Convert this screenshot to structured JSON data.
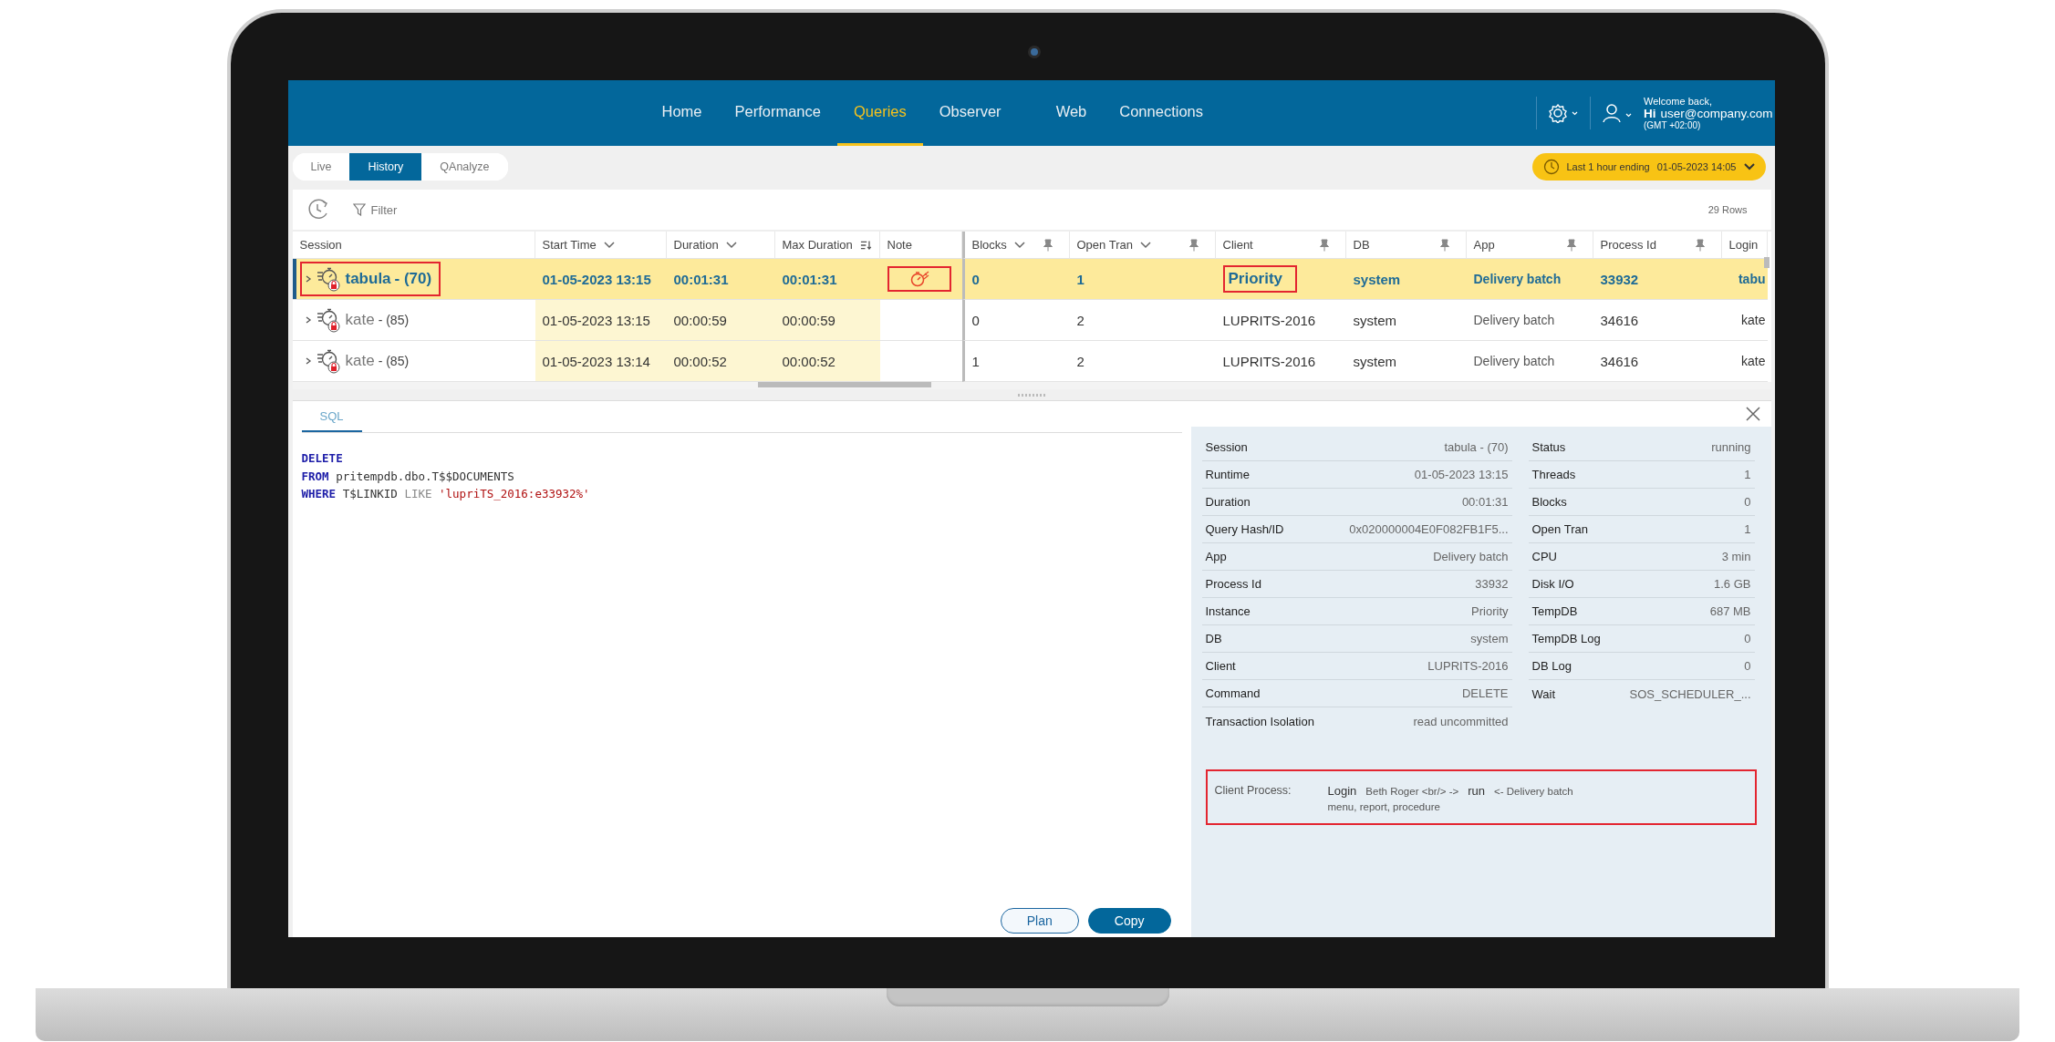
{
  "header": {
    "nav_items": [
      {
        "label": "Home",
        "selected": false
      },
      {
        "label": "Performance",
        "selected": false
      },
      {
        "label": "Queries",
        "selected": true
      },
      {
        "label": "Observer",
        "selected": false
      },
      {
        "label": "Web",
        "selected": false
      },
      {
        "label": "Connections",
        "selected": false
      }
    ],
    "welcome": "Welcome back,",
    "greeting": "Hi",
    "user": "user@company.com",
    "timezone": "(GMT +02:00)"
  },
  "view_tabs": [
    {
      "label": "Live",
      "selected": false
    },
    {
      "label": "History",
      "selected": true
    },
    {
      "label": "QAnalyze",
      "selected": false
    }
  ],
  "time_range": {
    "label": "Last 1 hour ending",
    "end": "01-05-2023 14:05"
  },
  "toolbar": {
    "filter": "Filter",
    "row_count": "29 Rows"
  },
  "table": {
    "columns": [
      {
        "label": "Session",
        "kind": "plain",
        "pinned": false,
        "shaded": false
      },
      {
        "label": "Start Time",
        "kind": "chevron",
        "pinned": false,
        "shaded": true
      },
      {
        "label": "Duration",
        "kind": "chevron",
        "pinned": false,
        "shaded": true
      },
      {
        "label": "Max Duration",
        "kind": "sort",
        "pinned": false,
        "shaded": true
      },
      {
        "label": "Note",
        "kind": "plain",
        "pinned": false,
        "shaded": false
      },
      {
        "label": "Blocks",
        "kind": "chevron",
        "pinned": true,
        "shaded": false
      },
      {
        "label": "Open Tran",
        "kind": "chevron",
        "pinned": true,
        "shaded": false
      },
      {
        "label": "Client",
        "kind": "plain",
        "pinned": true,
        "shaded": false
      },
      {
        "label": "DB",
        "kind": "plain",
        "pinned": true,
        "shaded": false
      },
      {
        "label": "App",
        "kind": "plain",
        "pinned": true,
        "shaded": false
      },
      {
        "label": "Process Id",
        "kind": "plain",
        "pinned": true,
        "shaded": false
      },
      {
        "label": "Login",
        "kind": "plain",
        "pinned": false,
        "shaded": false
      }
    ],
    "rows": [
      {
        "selected": true,
        "session": {
          "name": "tabula",
          "id": "- (70)",
          "outlined": true
        },
        "start_time": "01-05-2023 13:15",
        "duration": "00:01:31",
        "max_duration": "00:01:31",
        "note": {
          "icon": true,
          "outlined": true
        },
        "blocks": "0",
        "open_tran": "1",
        "client": {
          "text": "Priority",
          "outlined": true
        },
        "db": "system",
        "app": "Delivery batch",
        "process_id": "33932",
        "login": "tabu"
      },
      {
        "selected": false,
        "session": {
          "name": "kate",
          "id": "- (85)",
          "outlined": false
        },
        "start_time": "01-05-2023 13:15",
        "duration": "00:00:59",
        "max_duration": "00:00:59",
        "note": {
          "icon": false,
          "outlined": false
        },
        "blocks": "0",
        "open_tran": "2",
        "client": {
          "text": "LUPRITS-2016",
          "outlined": false
        },
        "db": "system",
        "app": "Delivery batch",
        "process_id": "34616",
        "login": "kate"
      },
      {
        "selected": false,
        "session": {
          "name": "kate",
          "id": "- (85)",
          "outlined": false
        },
        "start_time": "01-05-2023 13:14",
        "duration": "00:00:52",
        "max_duration": "00:00:52",
        "note": {
          "icon": false,
          "outlined": false
        },
        "blocks": "1",
        "open_tran": "2",
        "client": {
          "text": "LUPRITS-2016",
          "outlined": false
        },
        "db": "system",
        "app": "Delivery batch",
        "process_id": "34616",
        "login": "kate"
      }
    ]
  },
  "sql": {
    "tab": "SQL",
    "lines": [
      [
        {
          "kind": "keyword",
          "text": "DELETE"
        }
      ],
      [
        {
          "kind": "keyword",
          "text": "FROM"
        },
        {
          "kind": "plain",
          "text": " pritempdb.dbo.T$$DOCUMENTS"
        }
      ],
      [
        {
          "kind": "keyword",
          "text": "WHERE"
        },
        {
          "kind": "plain",
          "text": " T$LINKID "
        },
        {
          "kind": "operator",
          "text": "LIKE"
        },
        {
          "kind": "string",
          "text": " 'lupriTS_2016:e33932%'"
        }
      ]
    ],
    "buttons": [
      {
        "label": "Plan",
        "kind": "outline"
      },
      {
        "label": "Copy",
        "kind": "primary"
      }
    ]
  },
  "details": {
    "left": [
      {
        "label": "Session",
        "value": "tabula - (70)"
      },
      {
        "label": "Runtime",
        "value": "01-05-2023 13:15"
      },
      {
        "label": "Duration",
        "value": "00:01:31"
      },
      {
        "label": "Query Hash/ID",
        "value": "0x020000004E0F082FB1F5..."
      },
      {
        "label": "App",
        "value": "Delivery batch"
      },
      {
        "label": "Process Id",
        "value": "33932"
      },
      {
        "label": "Instance",
        "value": "Priority"
      },
      {
        "label": "DB",
        "value": "system"
      },
      {
        "label": "Client",
        "value": "LUPRITS-2016"
      },
      {
        "label": "Command",
        "value": "DELETE"
      },
      {
        "label": "Transaction Isolation",
        "value": "read uncommitted"
      }
    ],
    "right": [
      {
        "label": "Status",
        "value": "running"
      },
      {
        "label": "Threads",
        "value": "1"
      },
      {
        "label": "Blocks",
        "value": "0"
      },
      {
        "label": "Open Tran",
        "value": "1"
      },
      {
        "label": "CPU",
        "value": "3 min"
      },
      {
        "label": "Disk I/O",
        "value": "1.6 GB"
      },
      {
        "label": "TempDB",
        "value": "687 MB"
      },
      {
        "label": "TempDB Log",
        "value": "0"
      },
      {
        "label": "DB Log",
        "value": "0"
      },
      {
        "label": "Wait",
        "value": "SOS_SCHEDULER_..."
      }
    ],
    "client_process": {
      "outlined": true,
      "label": "Client Process:",
      "parts": [
        {
          "kind": "key",
          "text": "Login"
        },
        {
          "kind": "value",
          "text": "Beth Roger <br/> ->"
        },
        {
          "kind": "key",
          "text": "run"
        },
        {
          "kind": "value",
          "text": "<-  Delivery batch"
        }
      ],
      "second_line": "menu, report, procedure"
    }
  }
}
